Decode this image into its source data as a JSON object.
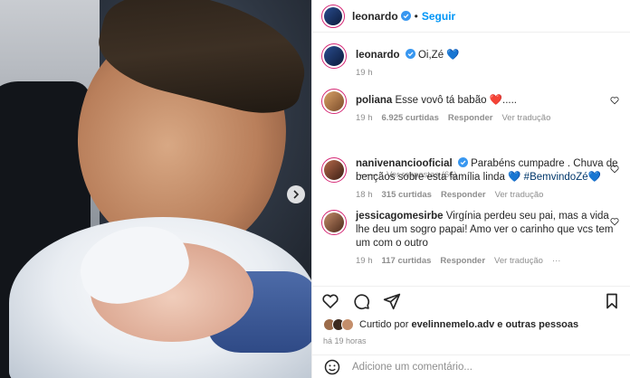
{
  "post": {
    "username": "leonardo",
    "follow_label": "Seguir",
    "separator": "•"
  },
  "colors": {
    "accent": "#0095f6",
    "verified": "#3897f0",
    "heart": "#ed4956"
  },
  "comments": [
    {
      "username": "leonardo",
      "text": "Oi,Zé",
      "emoji": "💙",
      "time": "19 h",
      "likes": "",
      "reply": "",
      "translate": ""
    },
    {
      "username": "poliana",
      "text": "Esse vovô tá babão",
      "emoji": "❤️.....",
      "time": "19 h",
      "likes": "6.925 curtidas",
      "reply": "Responder",
      "translate": "Ver tradução",
      "replies_label": "Ver respostas (66)"
    },
    {
      "username": "nanivenanciooficial",
      "text": "Parabéns cumpadre . Chuva de bençãos sobre esta família linda",
      "emoji": "💙",
      "tag": "#BemvindoZé",
      "emoji2": "💙",
      "time": "18 h",
      "likes": "315 curtidas",
      "reply": "Responder",
      "translate": "Ver tradução"
    },
    {
      "username": "jessicagomesirbe",
      "text": "Virgínia perdeu seu pai, mas a vida lhe deu um sogro papai! Amo ver o carinho que vcs tem um com o outro",
      "time": "19 h",
      "likes": "117 curtidas",
      "reply": "Responder",
      "translate": "Ver tradução",
      "more": "···"
    }
  ],
  "likes_summary": {
    "prefix": "Curtido por",
    "user": "evelinnemelo.adv",
    "suffix": "e outras pessoas"
  },
  "post_time": "há 19 horas",
  "add_comment": {
    "placeholder": "Adicione um comentário..."
  },
  "icons": [
    "heart-icon",
    "comment-icon",
    "share-icon",
    "bookmark-icon",
    "emoji-icon",
    "chevron-right-icon",
    "verified-icon"
  ]
}
